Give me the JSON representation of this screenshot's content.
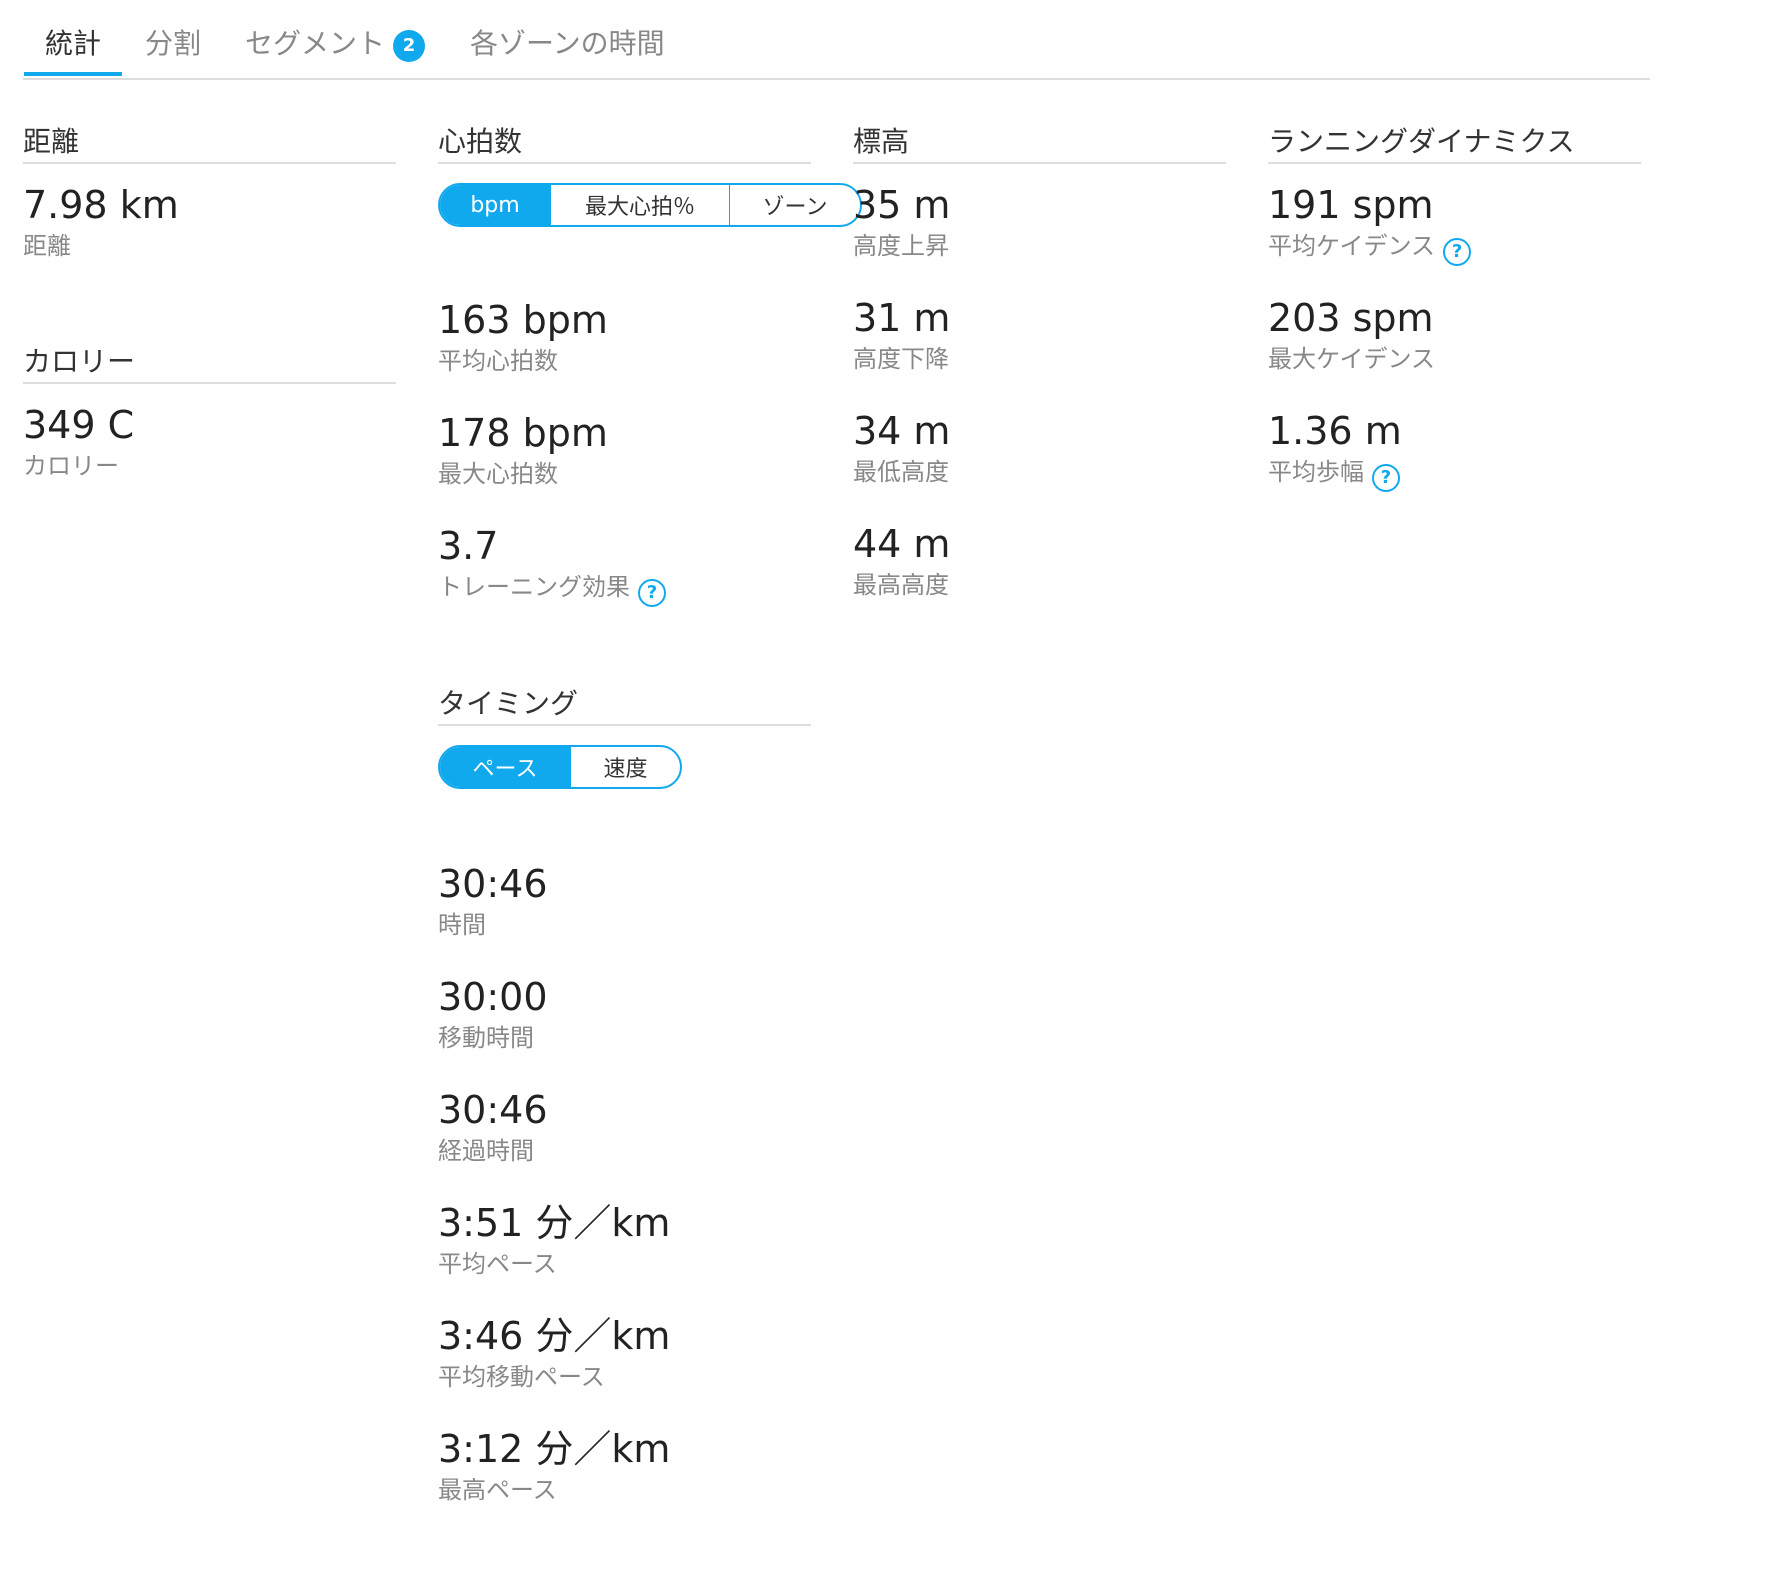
{
  "tabs": {
    "stats": "統計",
    "splits": "分割",
    "segments": "セグメント",
    "segments_badge": "2",
    "zones": "各ゾーンの時間"
  },
  "distance": {
    "header": "距離",
    "value": "7.98 km",
    "label": "距離"
  },
  "calories": {
    "header": "カロリー",
    "value": "349 C",
    "label": "カロリー"
  },
  "heart_rate": {
    "header": "心拍数",
    "toggle": {
      "bpm": "bpm",
      "max_hr_pct": "最大心拍％",
      "zones": "ゾーン",
      "selected": "bpm"
    },
    "avg_value": "163 bpm",
    "avg_label": "平均心拍数",
    "max_value": "178 bpm",
    "max_label": "最大心拍数",
    "te_value": "3.7",
    "te_label": "トレーニング効果"
  },
  "timing": {
    "header": "タイミング",
    "toggle": {
      "pace": "ペース",
      "speed": "速度",
      "selected": "ペース"
    },
    "time_value": "30:46",
    "time_label": "時間",
    "moving_value": "30:00",
    "moving_label": "移動時間",
    "elapsed_value": "30:46",
    "elapsed_label": "経過時間",
    "avg_pace_value": "3:51 分／km",
    "avg_pace_label": "平均ペース",
    "avg_moving_pace_value": "3:46 分／km",
    "avg_moving_pace_label": "平均移動ペース",
    "best_pace_value": "3:12 分／km",
    "best_pace_label": "最高ペース"
  },
  "elevation": {
    "header": "標高",
    "gain_value": "35 m",
    "gain_label": "高度上昇",
    "loss_value": "31 m",
    "loss_label": "高度下降",
    "min_value": "34 m",
    "min_label": "最低高度",
    "max_value": "44 m",
    "max_label": "最高高度"
  },
  "running_dynamics": {
    "header": "ランニングダイナミクス",
    "avg_cadence_value": "191 spm",
    "avg_cadence_label": "平均ケイデンス",
    "max_cadence_value": "203 spm",
    "max_cadence_label": "最大ケイデンス",
    "avg_stride_value": "1.36 m",
    "avg_stride_label": "平均歩幅"
  },
  "help_glyph": "?",
  "colors": {
    "accent": "#11a9ed",
    "text": "#333333",
    "muted": "#888888",
    "divider": "#dddddd"
  }
}
